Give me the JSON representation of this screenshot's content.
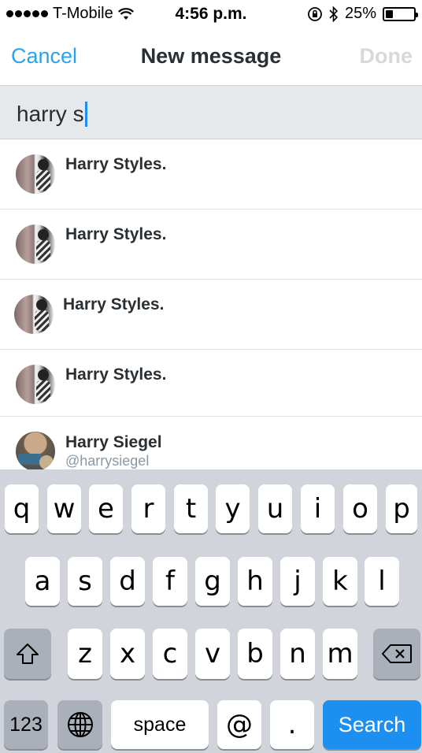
{
  "status_bar": {
    "carrier": "T-Mobile",
    "time": "4:56 p.m.",
    "battery": "25%",
    "battery_level": 0.25,
    "icons": [
      "signal-dots-icon",
      "wifi-icon",
      "rotation-lock-icon",
      "bluetooth-icon",
      "battery-icon"
    ]
  },
  "nav": {
    "cancel_label": "Cancel",
    "title": "New message",
    "done_label": "Done"
  },
  "search": {
    "value": "harry s"
  },
  "results": [
    {
      "name": "Harry Styles.",
      "handle": ""
    },
    {
      "name": "Harry Styles.",
      "handle": ""
    },
    {
      "name": "Harry Styles.",
      "handle": ""
    },
    {
      "name": "Harry Styles.",
      "handle": ""
    },
    {
      "name": "Harry Siegel",
      "handle": "@harrysiegel"
    }
  ],
  "keyboard": {
    "row1": [
      "q",
      "w",
      "e",
      "r",
      "t",
      "y",
      "u",
      "i",
      "o",
      "p"
    ],
    "row2": [
      "a",
      "s",
      "d",
      "f",
      "g",
      "h",
      "j",
      "k",
      "l"
    ],
    "row3": [
      "z",
      "x",
      "c",
      "v",
      "b",
      "n",
      "m"
    ],
    "numbers_label": "123",
    "space_label": "space",
    "at_label": "@",
    "dot_label": ".",
    "search_label": "Search"
  },
  "colors": {
    "accent": "#2aa3ef",
    "done_disabled": "#d6d9dc",
    "search_key": "#1d8ff0",
    "keyboard_bg": "#d1d5db"
  }
}
